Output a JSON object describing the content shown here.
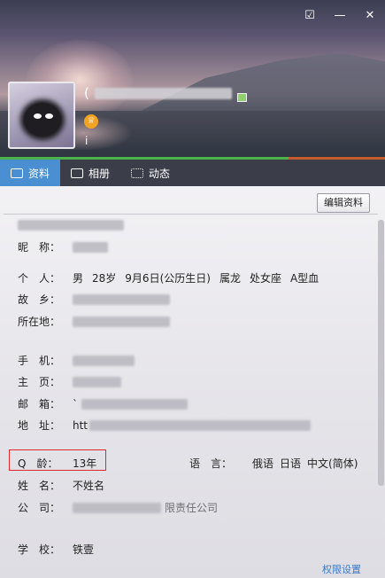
{
  "window": {
    "controls": [
      "shirt-icon",
      "minimize-icon",
      "close-icon"
    ]
  },
  "profile": {
    "name_prefix": "(",
    "info_icon": "i"
  },
  "tabs": [
    {
      "label": "资料",
      "icon": "profile-card-icon",
      "active": true
    },
    {
      "label": "相册",
      "icon": "photo-icon",
      "active": false
    },
    {
      "label": "动态",
      "icon": "feed-icon",
      "active": false
    }
  ],
  "toolbar": {
    "edit_label": "编辑资料"
  },
  "fields": {
    "nickname": {
      "label": "昵　称："
    },
    "person": {
      "label": "个　人：",
      "gender": "男",
      "age": "28岁",
      "birthday": "9月6日(公历生日)",
      "zodiac": "属龙",
      "star": "处女座",
      "blood": "A型血"
    },
    "hometown": {
      "label": "故　乡："
    },
    "location": {
      "label": "所在地："
    },
    "phone": {
      "label": "手　机："
    },
    "homepage": {
      "label": "主　页："
    },
    "email": {
      "label": "邮　箱：",
      "value": "`"
    },
    "address": {
      "label": "地　址：",
      "value": "htt"
    },
    "qage": {
      "label": "Q　龄：",
      "value": "13年"
    },
    "language": {
      "label": "语　言：",
      "values": [
        "俄语",
        "日语",
        "中文(简体)"
      ]
    },
    "realname": {
      "label": "姓　名：",
      "value": "不姓名"
    },
    "company": {
      "label": "公　司：",
      "value": "限责任公司"
    },
    "school": {
      "label": "学　校：",
      "value": "铁壹"
    }
  },
  "links": {
    "permission": "权限设置"
  },
  "colors": {
    "accent": "#4a8fd2",
    "highlight": "#e0282e",
    "link": "#3c78c8"
  },
  "progress": {
    "level": 0.75
  }
}
